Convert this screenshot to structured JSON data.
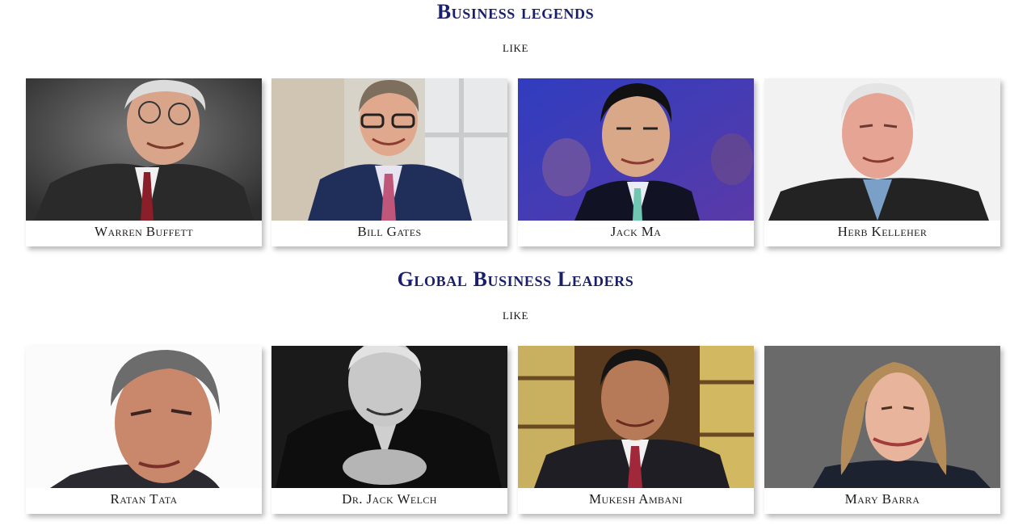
{
  "sections": [
    {
      "title": "Business legends",
      "subtitle": "like",
      "people": [
        {
          "name": "Warren Buffett"
        },
        {
          "name": "Bill Gates"
        },
        {
          "name": "Jack Ma"
        },
        {
          "name": "Herb Kelleher"
        }
      ]
    },
    {
      "title": "Global Business Leaders",
      "subtitle": "like",
      "people": [
        {
          "name": "Ratan Tata"
        },
        {
          "name": "Dr. Jack Welch"
        },
        {
          "name": "Mukesh Ambani"
        },
        {
          "name": "Mary Barra"
        }
      ]
    }
  ]
}
